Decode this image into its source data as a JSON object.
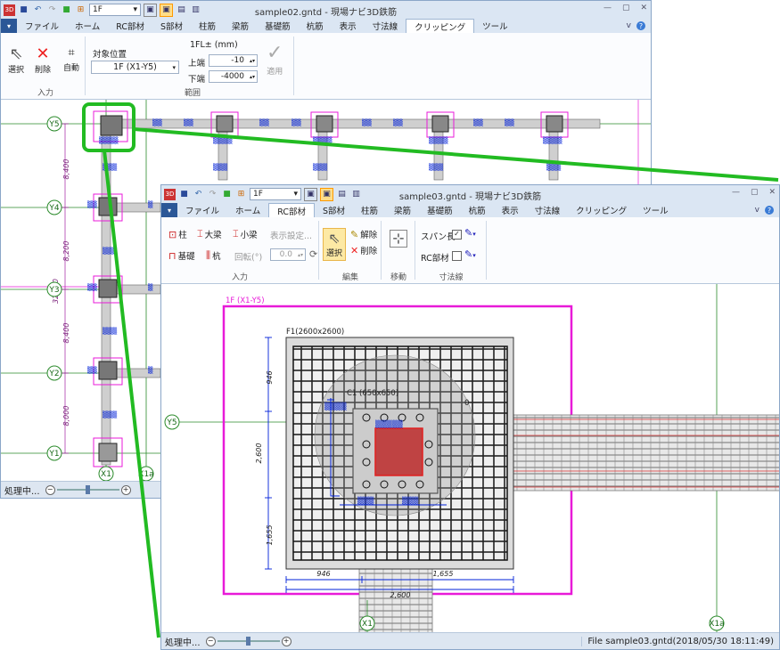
{
  "back_window": {
    "title": "sample02.gntd - 現場ナビ3D鉄筋",
    "floor_combo": "1F",
    "tabs": [
      "ファイル",
      "ホーム",
      "RC部材",
      "S部材",
      "柱筋",
      "梁筋",
      "基礎筋",
      "杭筋",
      "表示",
      "寸法線",
      "クリッピング",
      "ツール"
    ],
    "active_tab": "クリッピング",
    "ribbon": {
      "input_group": {
        "label": "入力",
        "select": "選択",
        "delete": "削除",
        "auto": "自動"
      },
      "range_group": {
        "label": "範囲",
        "target_label": "対象位置",
        "target_value": "1F (X1-Y5)",
        "fl_label": "1FL± (mm)",
        "top_label": "上端",
        "top_value": "-10",
        "bottom_label": "下端",
        "bottom_value": "-4000",
        "apply": "適用"
      }
    },
    "grid_labels": [
      "Y5",
      "Y4",
      "Y3",
      "Y2",
      "Y1",
      "X1",
      "X1a"
    ],
    "dims": [
      "8,400",
      "8,200",
      "8,400",
      "8,000",
      "32,000"
    ],
    "status": "処理中..."
  },
  "front_window": {
    "title": "sample03.gntd - 現場ナビ3D鉄筋",
    "floor_combo": "1F",
    "tabs": [
      "ファイル",
      "ホーム",
      "RC部材",
      "S部材",
      "柱筋",
      "梁筋",
      "基礎筋",
      "杭筋",
      "表示",
      "寸法線",
      "クリッピング",
      "ツール"
    ],
    "active_tab": "RC部材",
    "ribbon": {
      "input_group": {
        "label": "入力",
        "column": "柱",
        "big_beam": "大梁",
        "small_beam": "小梁",
        "display_settings": "表示設定...",
        "foundation": "基礎",
        "pile": "杭",
        "rotation_label": "回転(°)",
        "rotation_value": "0.0"
      },
      "edit_group": {
        "label": "編集",
        "select": "選択",
        "release": "解除",
        "delete": "削除"
      },
      "move_group": {
        "label": "移動"
      },
      "dim_group": {
        "label": "寸法線",
        "span_length": "スパン長",
        "rc_member": "RC部材"
      }
    },
    "canvas": {
      "clip_label": "1F (X1-Y5)",
      "footing_label": "F1(2600x2600)",
      "column_label": "C1 (650x650)",
      "zero_label": "0",
      "y_label": "Y5",
      "x_labels": [
        "X1",
        "X1a"
      ],
      "dims": [
        "946",
        "2,600",
        "1,655",
        "946",
        "1,655",
        "2,600"
      ]
    },
    "status": {
      "left": "処理中...",
      "right": "File sample03.gntd(2018/05/30 18:11:49)"
    }
  },
  "colors": {
    "magenta": "#e81ad8",
    "highlight_green": "#22bb22",
    "rebar_blue": "#0020d8",
    "column_red": "#e02020",
    "ribbon_blue": "#dbe6f3"
  }
}
